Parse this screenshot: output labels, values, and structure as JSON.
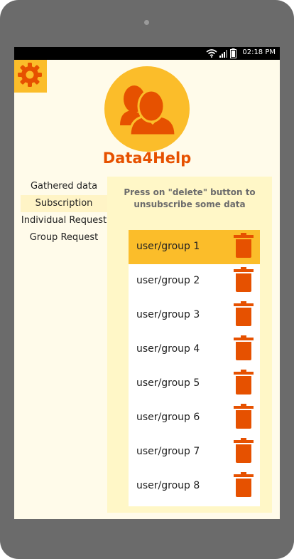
{
  "status_bar": {
    "time": "02:18 PM",
    "icons": [
      "wifi-icon",
      "signal-icon",
      "battery-icon"
    ]
  },
  "header": {
    "settings_icon": "gear-icon",
    "avatar_icon": "users-icon",
    "app_title": "Data4Help"
  },
  "menu": {
    "items": [
      {
        "label": "Gathered data"
      },
      {
        "label": "Subscription"
      },
      {
        "label": "Individual Request"
      },
      {
        "label": "Group Request"
      }
    ]
  },
  "panel": {
    "instruction": "Press on \"delete\" button to unsubscribe some data",
    "items": [
      {
        "label": "user/group 1"
      },
      {
        "label": "user/group 2"
      },
      {
        "label": "user/group 3"
      },
      {
        "label": "user/group 4"
      },
      {
        "label": "user/group 5"
      },
      {
        "label": "user/group 6"
      },
      {
        "label": "user/group 7"
      },
      {
        "label": "user/group 8"
      }
    ],
    "delete_icon": "trash-icon"
  },
  "colors": {
    "accent": "#fbbd2a",
    "brand": "#e65100",
    "background": "#fffbea",
    "panel": "#fff7c7"
  }
}
